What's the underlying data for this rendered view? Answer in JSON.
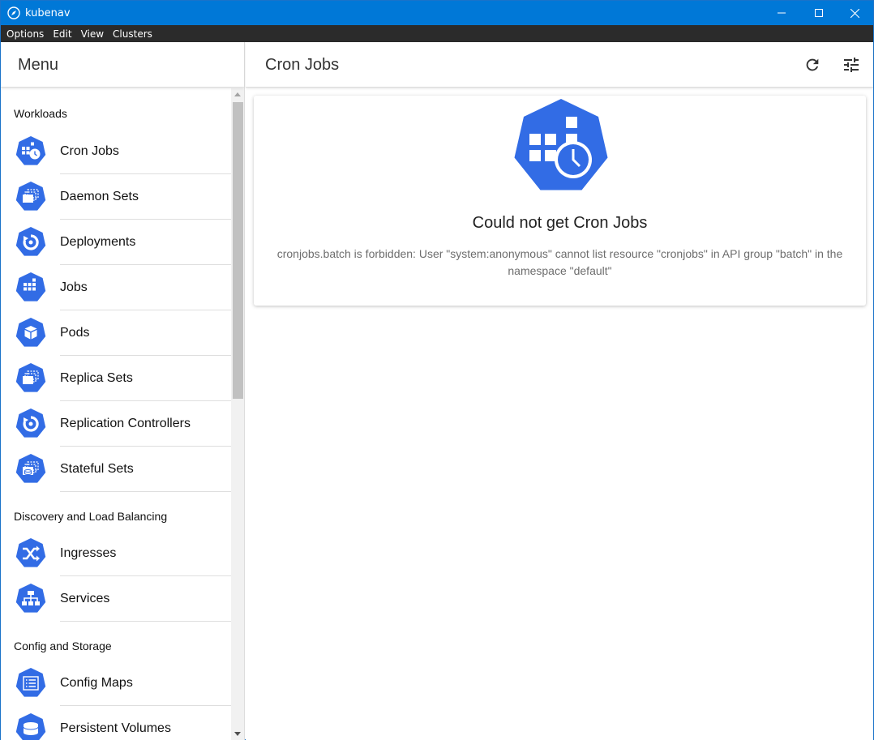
{
  "window": {
    "title": "kubenav",
    "accent": "#0078d7"
  },
  "menubar": {
    "items": [
      "Options",
      "Edit",
      "View",
      "Clusters"
    ]
  },
  "sidebar": {
    "title": "Menu",
    "sections": [
      {
        "label": "Workloads",
        "items": [
          {
            "label": "Cron Jobs",
            "icon": "cronjob-icon"
          },
          {
            "label": "Daemon Sets",
            "icon": "daemonset-icon"
          },
          {
            "label": "Deployments",
            "icon": "deployment-icon"
          },
          {
            "label": "Jobs",
            "icon": "job-icon"
          },
          {
            "label": "Pods",
            "icon": "pod-icon"
          },
          {
            "label": "Replica Sets",
            "icon": "replicaset-icon"
          },
          {
            "label": "Replication Controllers",
            "icon": "replication-controller-icon"
          },
          {
            "label": "Stateful Sets",
            "icon": "statefulset-icon"
          }
        ]
      },
      {
        "label": "Discovery and Load Balancing",
        "items": [
          {
            "label": "Ingresses",
            "icon": "ingress-icon"
          },
          {
            "label": "Services",
            "icon": "service-icon"
          }
        ]
      },
      {
        "label": "Config and Storage",
        "items": [
          {
            "label": "Config Maps",
            "icon": "configmap-icon"
          },
          {
            "label": "Persistent Volumes",
            "icon": "persistent-volume-icon"
          }
        ]
      }
    ]
  },
  "main": {
    "title": "Cron Jobs",
    "error": {
      "title": "Could not get Cron Jobs",
      "message": "cronjobs.batch is forbidden: User \"system:anonymous\" cannot list resource \"cronjobs\" in API group \"batch\" in the namespace \"default\""
    }
  },
  "colors": {
    "kube_blue": "#326ce5",
    "titlebar": "#0078d7",
    "menubar": "#2b2b2b"
  }
}
